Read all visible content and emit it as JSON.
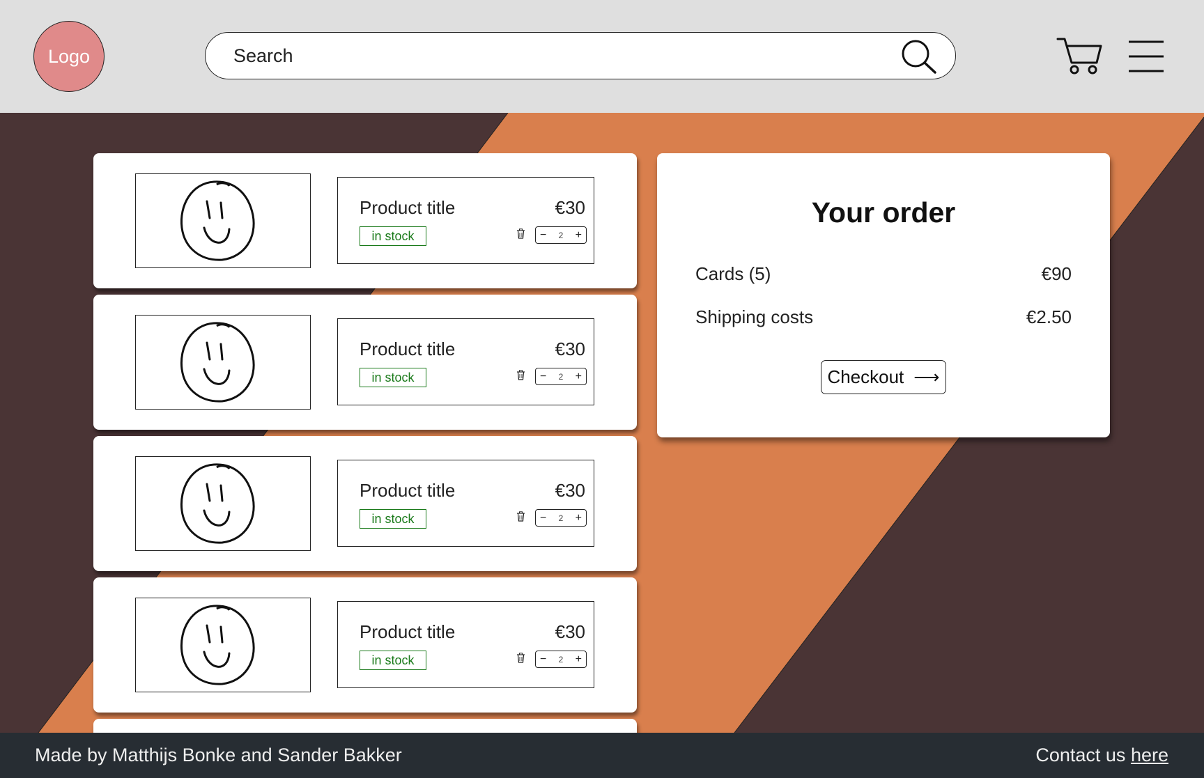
{
  "header": {
    "logo_label": "Logo",
    "search_placeholder": "Search"
  },
  "products": [
    {
      "title": "Product title",
      "price": "€30",
      "stock": "in stock",
      "quantity": "2"
    },
    {
      "title": "Product title",
      "price": "€30",
      "stock": "in stock",
      "quantity": "2"
    },
    {
      "title": "Product title",
      "price": "€30",
      "stock": "in stock",
      "quantity": "2"
    },
    {
      "title": "Product title",
      "price": "€30",
      "stock": "in stock",
      "quantity": "2"
    }
  ],
  "order": {
    "title": "Your order",
    "items_label": "Cards (5)",
    "items_value": "€90",
    "shipping_label": "Shipping costs",
    "shipping_value": "€2.50",
    "checkout_label": "Checkout",
    "checkout_arrow": "⟶"
  },
  "footer": {
    "credit": "Made by Matthijs Bonke and Sander Bakker",
    "contact_prefix": "Contact us",
    "contact_link": "here"
  },
  "colors": {
    "header_bg": "#dfdfdf",
    "dark_bg": "#4a3435",
    "orange_band": "#d97f4d",
    "logo": "#e08a8a",
    "stock_green": "#1a7a1a",
    "footer_bg": "#272d33"
  },
  "icons": [
    "search-icon",
    "cart-icon",
    "menu-icon",
    "trash-icon",
    "smiley-placeholder-icon",
    "arrow-right-icon"
  ]
}
